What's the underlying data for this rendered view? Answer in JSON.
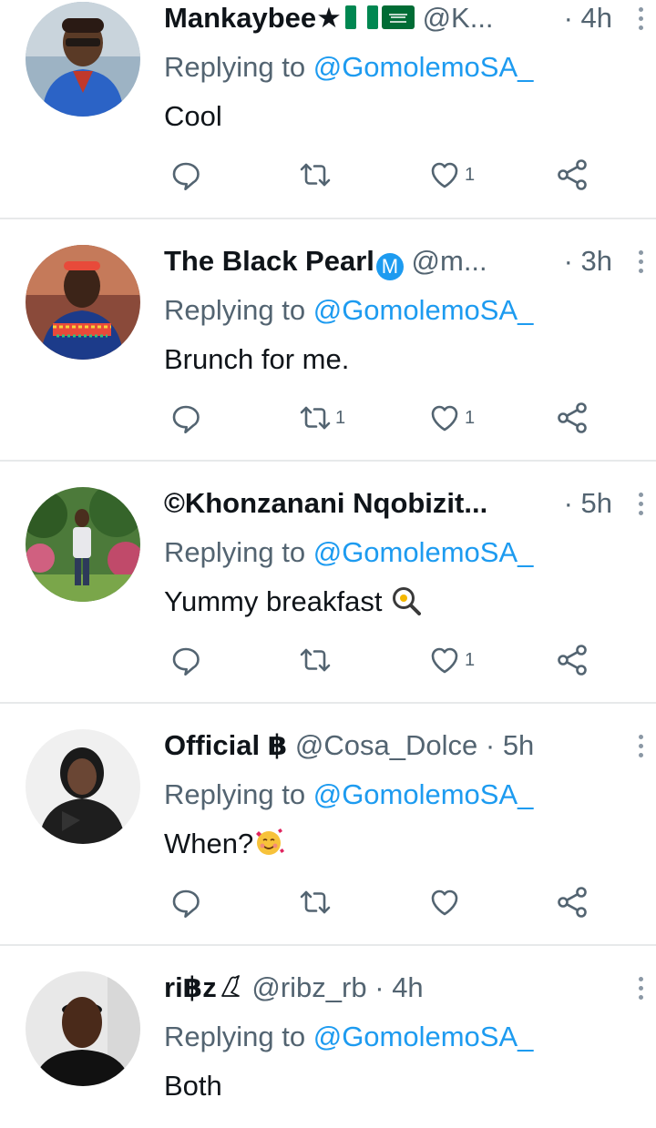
{
  "tweets": [
    {
      "display_name": "Mankaybee★",
      "handle": "@K...",
      "time": "4h",
      "replying_label": "Replying to",
      "replying_to": "@GomolemoSA_",
      "text": "Cool",
      "retweets": "",
      "likes": "1",
      "avatar": "man-blue-shirt-glasses"
    },
    {
      "display_name": "The Black Pearl",
      "badge": "M",
      "handle": "@m...",
      "time": "3h",
      "replying_label": "Replying to",
      "replying_to": "@GomolemoSA_",
      "text": "Brunch for me.",
      "retweets": "1",
      "likes": "1",
      "avatar": "woman-beaded-attire"
    },
    {
      "display_name": "©Khonzanani Nqobizit...",
      "handle": "",
      "time": "5h",
      "replying_label": "Replying to",
      "replying_to": "@GomolemoSA_",
      "text": "Yummy breakfast",
      "emoji": "frying-pan-egg",
      "retweets": "",
      "likes": "1",
      "avatar": "man-standing-garden"
    },
    {
      "display_name": "Official ฿",
      "handle": "@Cosa_Dolce",
      "time": "5h",
      "replying_label": "Replying to",
      "replying_to": "@GomolemoSA_",
      "text": "When?",
      "emoji": "smiling-face-with-hearts",
      "retweets": "",
      "likes": "",
      "avatar": "woman-black-jacket"
    },
    {
      "display_name": "ri฿z",
      "handle": "@ribz_rb",
      "time": "4h",
      "replying_label": "Replying to",
      "replying_to": "@GomolemoSA_",
      "text": "Both",
      "avatar": "man-portrait-white-wall"
    }
  ],
  "separator": "·",
  "colors": {
    "text": "#0f1419",
    "secondary": "#536471",
    "accent": "#1d9bf0",
    "divider": "#e7e9ea"
  }
}
